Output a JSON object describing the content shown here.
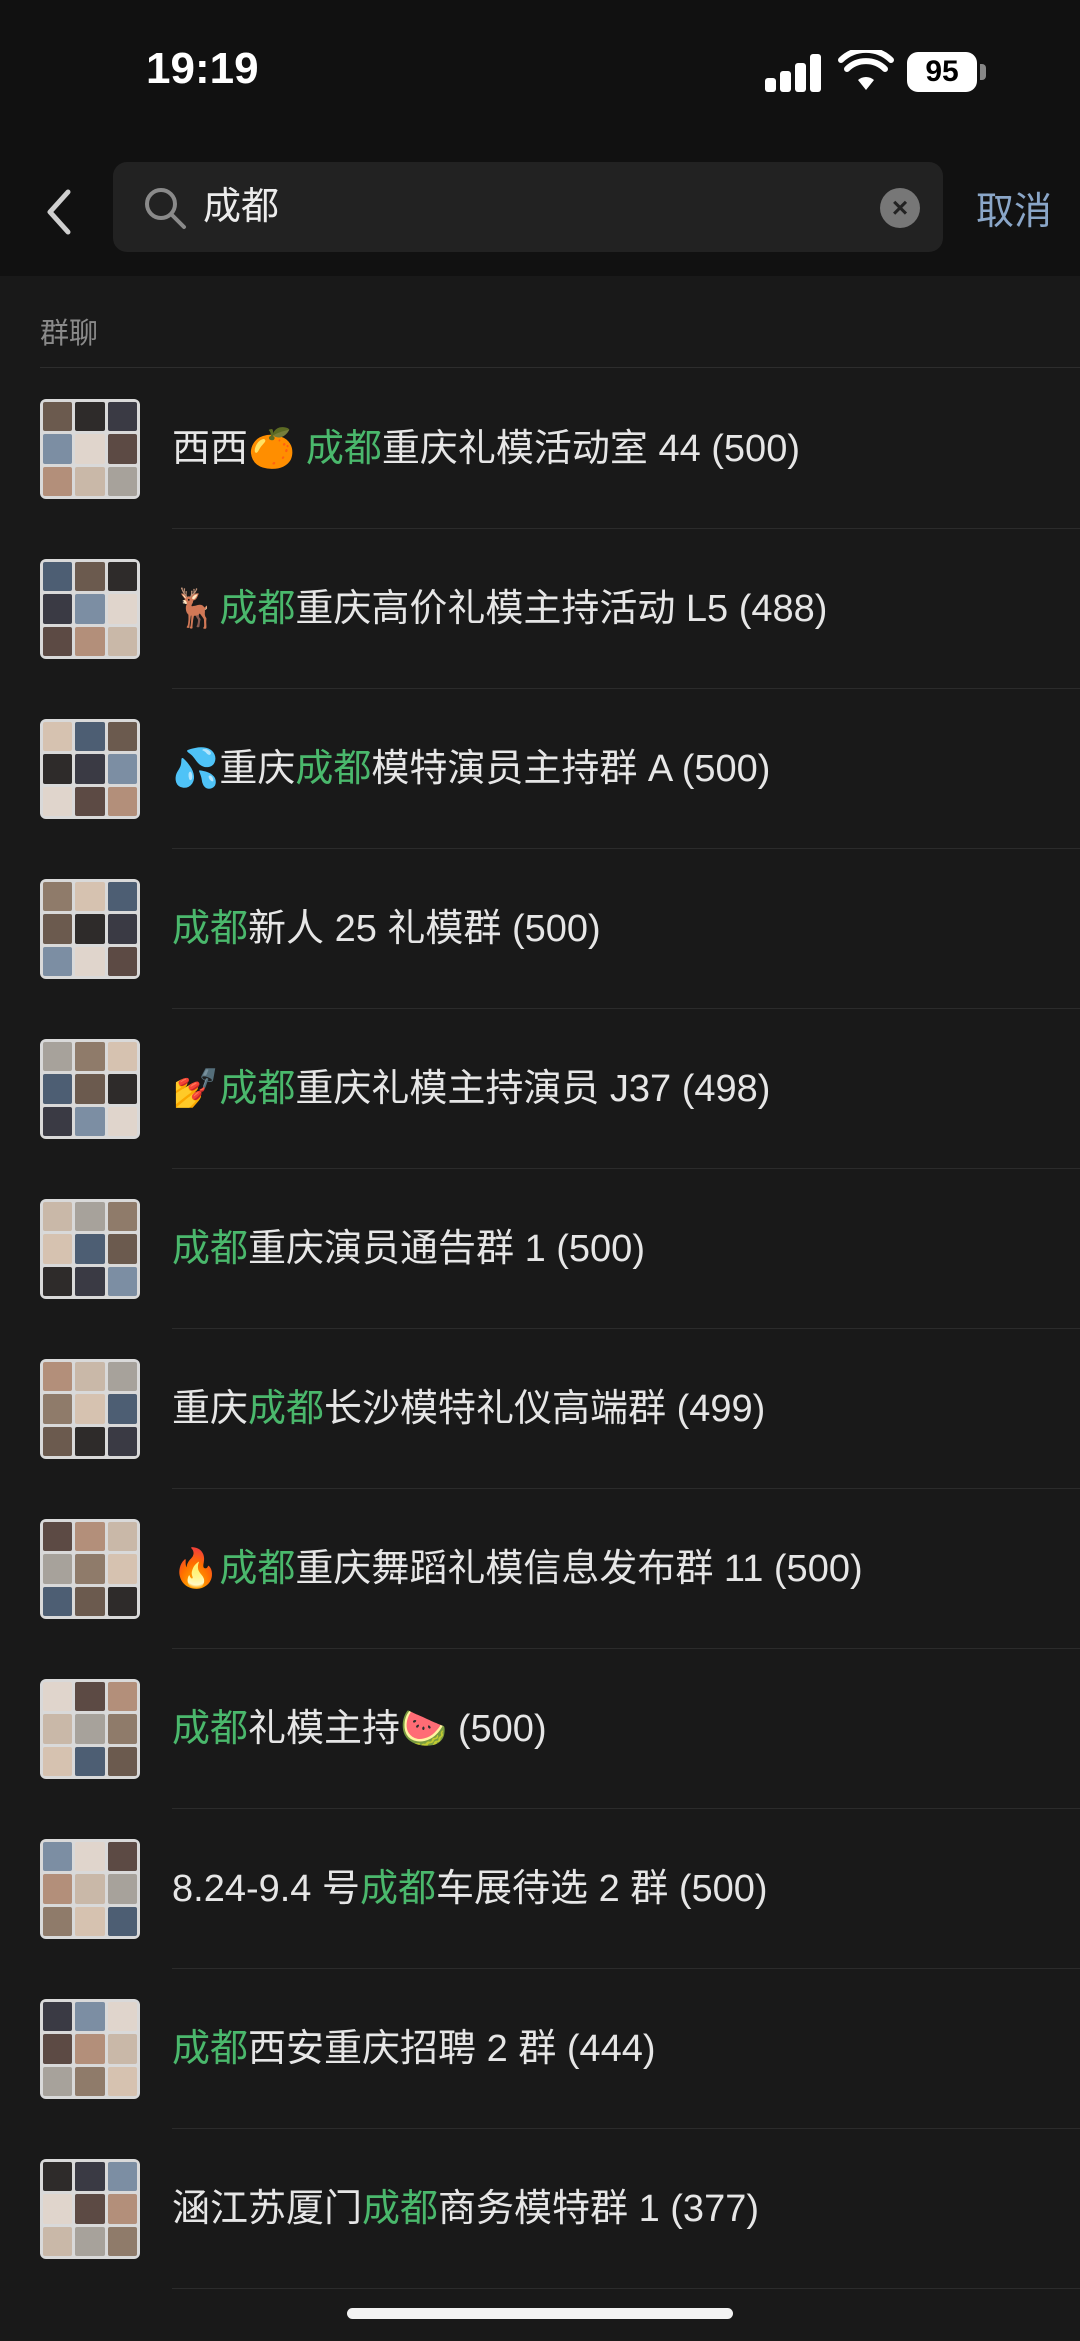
{
  "status_bar": {
    "time": "19:19",
    "battery": "95"
  },
  "search": {
    "query": "成都",
    "cancel_label": "取消"
  },
  "section": {
    "label": "群聊"
  },
  "highlight_color": "#4ab86c",
  "groups": [
    {
      "pre": "西西🍊 ",
      "hl": "成都",
      "post": "重庆礼模活动室 44 (500)"
    },
    {
      "pre": "🦌",
      "hl": "成都",
      "post": "重庆高价礼模主持活动 L5 (488)"
    },
    {
      "pre": "💦重庆",
      "hl": "成都",
      "post": "模特演员主持群 A (500)"
    },
    {
      "pre": "",
      "hl": "成都",
      "post": "新人 25 礼模群 (500)"
    },
    {
      "pre": "💅",
      "hl": "成都",
      "post": "重庆礼模主持演员 J37 (498)"
    },
    {
      "pre": "",
      "hl": "成都",
      "post": "重庆演员通告群 1 (500)"
    },
    {
      "pre": "重庆",
      "hl": "成都",
      "post": "长沙模特礼仪高端群 (499)"
    },
    {
      "pre": "🔥",
      "hl": "成都",
      "post": "重庆舞蹈礼模信息发布群 11 (500)"
    },
    {
      "pre": "",
      "hl": "成都",
      "post": "礼模主持🍉 (500)"
    },
    {
      "pre": "8.24-9.4 号",
      "hl": "成都",
      "post": "车展待选 2 群 (500)"
    },
    {
      "pre": "",
      "hl": "成都",
      "post": "西安重庆招聘 2 群 (444)"
    },
    {
      "pre": "涵江苏厦门",
      "hl": "成都",
      "post": "商务模特群 1 (377)"
    }
  ]
}
